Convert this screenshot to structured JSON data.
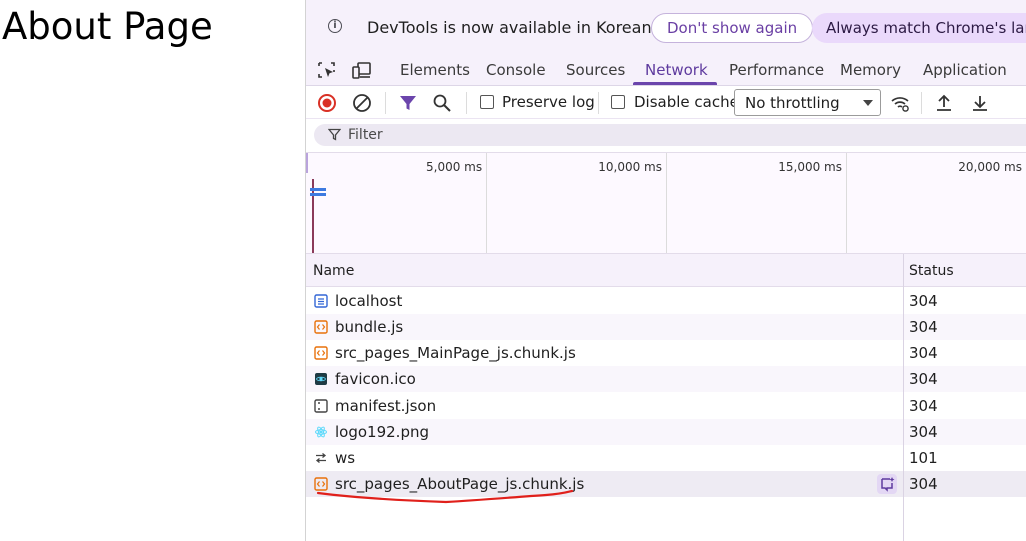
{
  "page": {
    "heading": "About Page"
  },
  "infobar": {
    "message": "DevTools is now available in Korean",
    "dont_show_label": "Don't show again",
    "always_match_label": "Always match Chrome's langu"
  },
  "tabs": [
    {
      "label": "Elements",
      "active": false
    },
    {
      "label": "Console",
      "active": false
    },
    {
      "label": "Sources",
      "active": false
    },
    {
      "label": "Network",
      "active": true
    },
    {
      "label": "Performance",
      "active": false
    },
    {
      "label": "Memory",
      "active": false
    },
    {
      "label": "Application",
      "active": false
    }
  ],
  "toolbar": {
    "preserve_log_label": "Preserve log",
    "preserve_log_checked": false,
    "disable_cache_label": "Disable cache",
    "disable_cache_checked": false,
    "throttling_value": "No throttling"
  },
  "filter": {
    "placeholder": "Filter"
  },
  "overview": {
    "tick_labels": [
      "5,000 ms",
      "10,000 ms",
      "15,000 ms",
      "20,000 ms"
    ]
  },
  "table": {
    "columns": {
      "name": "Name",
      "status": "Status"
    },
    "rows": [
      {
        "name": "localhost",
        "status": "304",
        "icon": "document-icon"
      },
      {
        "name": "bundle.js",
        "status": "304",
        "icon": "script-icon"
      },
      {
        "name": "src_pages_MainPage_js.chunk.js",
        "status": "304",
        "icon": "script-icon"
      },
      {
        "name": "favicon.ico",
        "status": "304",
        "icon": "favicon-image-icon"
      },
      {
        "name": "manifest.json",
        "status": "304",
        "icon": "manifest-icon"
      },
      {
        "name": "logo192.png",
        "status": "304",
        "icon": "react-image-icon"
      },
      {
        "name": "ws",
        "status": "101",
        "icon": "websocket-icon"
      },
      {
        "name": "src_pages_AboutPage_js.chunk.js",
        "status": "304",
        "icon": "script-icon"
      }
    ]
  },
  "colors": {
    "accent": "#6b45ac",
    "record_red": "#d93025",
    "script_orange": "#e8710a",
    "annotation_red": "#e0201b"
  }
}
